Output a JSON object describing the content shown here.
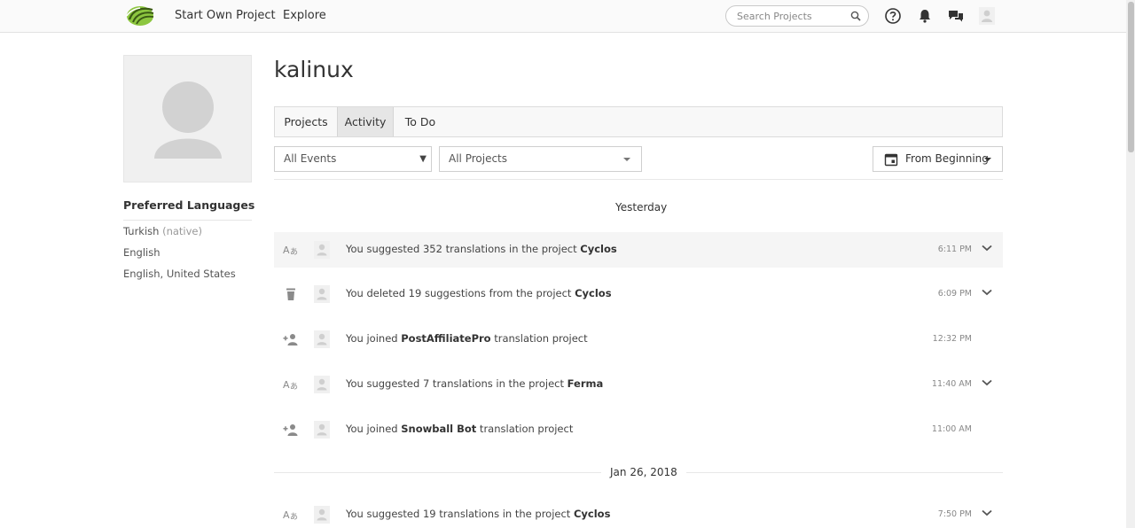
{
  "nav": {
    "start_label": "Start Own Project",
    "explore_label": "Explore",
    "search_placeholder": "Search Projects"
  },
  "profile": {
    "username": "kalinux",
    "languages_title": "Preferred Languages",
    "languages": [
      {
        "name": "Turkish",
        "note": "(native)"
      },
      {
        "name": "English",
        "note": ""
      },
      {
        "name": "English, United States",
        "note": ""
      }
    ]
  },
  "tabs": [
    {
      "label": "Projects",
      "active": false
    },
    {
      "label": "Activity",
      "active": true
    },
    {
      "label": "To Do",
      "active": false
    }
  ],
  "filters": {
    "events_selected": "All Events",
    "projects_selected": "All Projects",
    "date_label": "From Beginning"
  },
  "groups": [
    {
      "label": "Yesterday"
    },
    {
      "label": "Jan 26, 2018"
    }
  ],
  "events": [
    {
      "icon": "translate-icon",
      "pre": "You suggested 352 translations in the project ",
      "bold": "Cyclos",
      "post": "",
      "time": "6:11 PM",
      "expandable": true
    },
    {
      "icon": "trash-icon",
      "pre": "You deleted 19 suggestions from the project ",
      "bold": "Cyclos",
      "post": "",
      "time": "6:09 PM",
      "expandable": true
    },
    {
      "icon": "person-add-icon",
      "pre": "You joined ",
      "bold": "PostAffiliatePro",
      "post": " translation project",
      "time": "12:32 PM",
      "expandable": false
    },
    {
      "icon": "translate-icon",
      "pre": "You suggested 7 translations in the project ",
      "bold": "Ferma",
      "post": "",
      "time": "11:40 AM",
      "expandable": true
    },
    {
      "icon": "person-add-icon",
      "pre": "You joined ",
      "bold": "Snowball Bot",
      "post": " translation project",
      "time": "11:00 AM",
      "expandable": false
    },
    {
      "icon": "translate-icon",
      "pre": "You suggested 19 translations in the project ",
      "bold": "Cyclos",
      "post": "",
      "time": "7:50 PM",
      "expandable": true
    }
  ],
  "colors": {
    "logo_green": "#8cc63f",
    "icon_gray": "#8a8a8a",
    "highlight_row": "#f5f5f5"
  }
}
